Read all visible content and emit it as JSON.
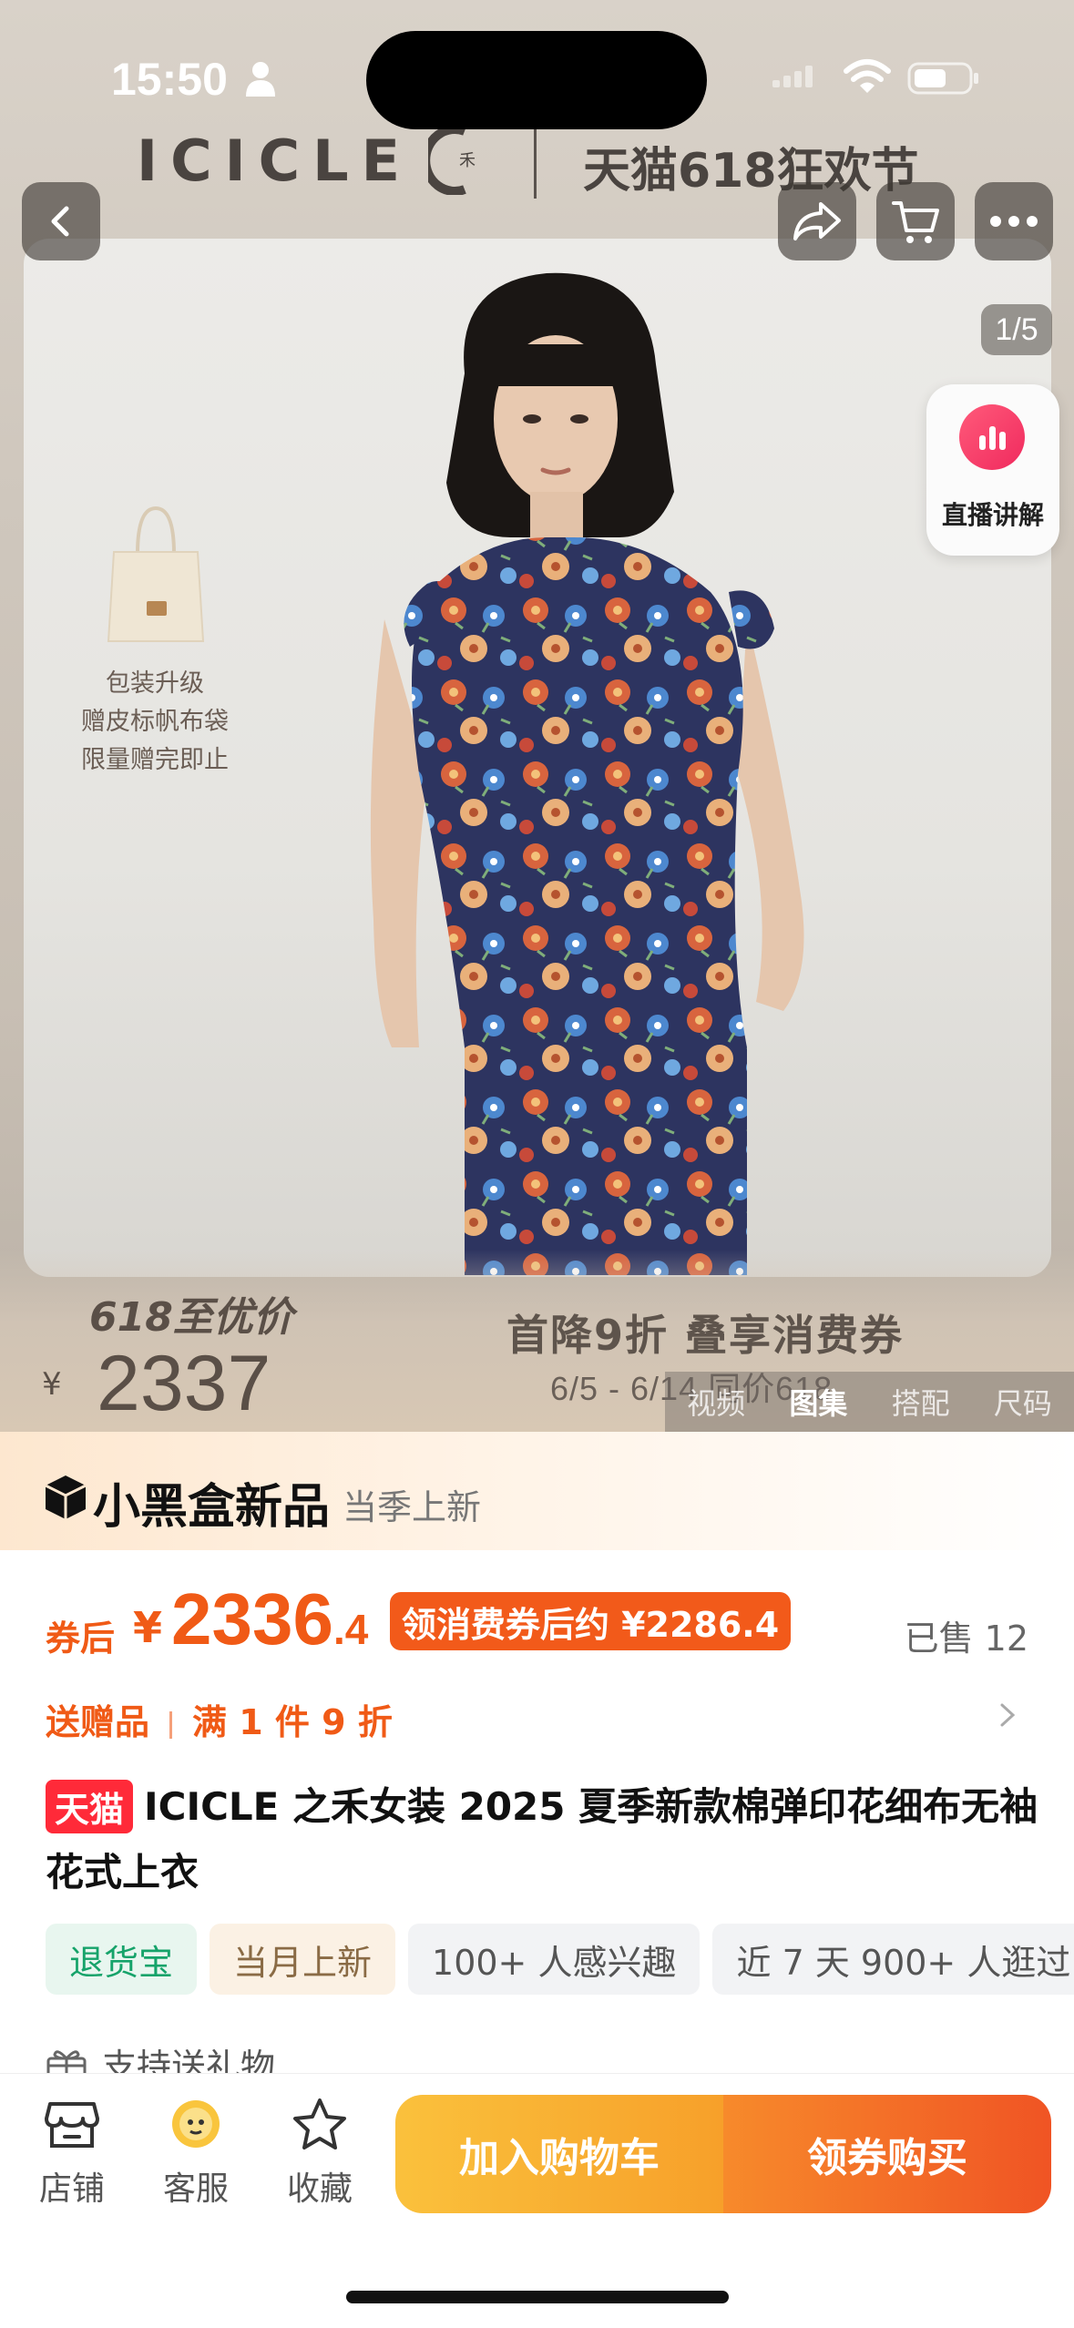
{
  "status_bar": {
    "time": "15:50"
  },
  "hero": {
    "brand": "ICICLE",
    "event": "天猫618狂欢节",
    "counter": "1/5",
    "live_label": "直播讲解",
    "promo_note": [
      "包装升级",
      "赠皮标帆布袋",
      "限量赠完即止"
    ],
    "price_label": "618至优价",
    "price_yen": "¥",
    "price_value": "2337",
    "promo_line1": "首降9折 叠享消费券",
    "promo_line2": "6/5 - 6/14 同价618",
    "media_tabs": [
      {
        "label": "视频",
        "active": false
      },
      {
        "label": "图集",
        "active": true
      },
      {
        "label": "搭配",
        "active": false
      },
      {
        "label": "尺码",
        "active": false
      }
    ]
  },
  "blackbox": {
    "title": "小黑盒新品",
    "subtitle": "当季上新"
  },
  "price": {
    "coupon_after_label": "券后",
    "yen": "¥",
    "integer": "2336",
    "decimal": ".4",
    "coupon_badge": "领消费券后约 ¥2286.4",
    "sold": "已售 12"
  },
  "gift": {
    "send_gift": "送赠品",
    "discount": "满 1 件 9 折"
  },
  "product": {
    "store_badge": "天猫",
    "title": "ICICLE 之禾女装 2025 夏季新款棉弹印花细布无袖花式上衣"
  },
  "tags": [
    {
      "label": "退货宝",
      "style": "green"
    },
    {
      "label": "当月上新",
      "style": "tan"
    },
    {
      "label": "100+ 人感兴趣",
      "style": "gray"
    },
    {
      "label": "近 7 天 900+ 人逛过",
      "style": "gray"
    }
  ],
  "support": {
    "label": "支持送礼物"
  },
  "bottom_nav": {
    "store": "店铺",
    "service": "客服",
    "favorite": "收藏",
    "add_to_cart": "加入购物车",
    "buy": "领券购买"
  },
  "colors": {
    "accent": "#f05a16",
    "tmall_red": "#ff2a39",
    "cart_yellow": "#fac13c",
    "buy_orange": "#f05424"
  }
}
